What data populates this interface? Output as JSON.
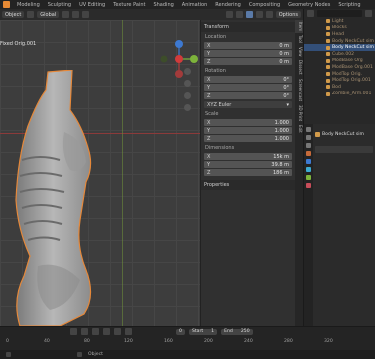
{
  "menubar": {
    "tabs": [
      "Modeling",
      "Sculpting",
      "UV Editing",
      "Texture Paint",
      "Shading",
      "Animation",
      "Rendering",
      "Compositing",
      "Geometry Nodes",
      "Scripting"
    ],
    "active_index": 0
  },
  "viewport_header": {
    "mode": "Object",
    "orientation": "Global",
    "options_label": "Options"
  },
  "viewport": {
    "view_label": "Fixed Orig.001"
  },
  "npanel": {
    "transform_title": "Transform",
    "location_label": "Location",
    "location": [
      {
        "axis": "X",
        "value": "0 m"
      },
      {
        "axis": "Y",
        "value": "0 m"
      },
      {
        "axis": "Z",
        "value": "0 m"
      }
    ],
    "rotation_label": "Rotation",
    "rotation": [
      {
        "axis": "X",
        "value": "0°"
      },
      {
        "axis": "Y",
        "value": "0°"
      },
      {
        "axis": "Z",
        "value": "0°"
      }
    ],
    "rotation_mode": "XYZ Euler",
    "scale_label": "Scale",
    "scale": [
      {
        "axis": "X",
        "value": "1.000"
      },
      {
        "axis": "Y",
        "value": "1.000"
      },
      {
        "axis": "Z",
        "value": "1.000"
      }
    ],
    "dimensions_label": "Dimensions",
    "dimensions": [
      {
        "axis": "X",
        "value": "15k m"
      },
      {
        "axis": "Y",
        "value": "39.8 m"
      },
      {
        "axis": "Z",
        "value": "186 m"
      }
    ],
    "properties_title": "Properties",
    "tabs": [
      "Item",
      "Tool",
      "View",
      "Dissect",
      "Screencast",
      "3D Print",
      "Edit"
    ]
  },
  "outliner": {
    "items": [
      {
        "label": "Light",
        "selected": false
      },
      {
        "label": "Blocks",
        "selected": false
      },
      {
        "label": "Head",
        "selected": false
      },
      {
        "label": "Body NeckCut sim",
        "selected": false
      },
      {
        "label": "Body NeckCut sim",
        "selected": true
      },
      {
        "label": "Cube.002",
        "selected": false
      },
      {
        "label": "ModBase Org",
        "selected": false
      },
      {
        "label": "ModBase Org.001",
        "selected": false
      },
      {
        "label": "ModTop Orig.",
        "selected": false
      },
      {
        "label": "ModTop Orig.001",
        "selected": false
      },
      {
        "label": "Bod",
        "selected": false
      },
      {
        "label": "Zombie_Arm.001",
        "selected": false
      }
    ]
  },
  "properties": {
    "object_name": "Body NeckCut sim"
  },
  "timeline": {
    "current_frame": "0",
    "start_label": "Start",
    "start_value": "1",
    "end_label": "End",
    "end_value": "250",
    "ruler_ticks": [
      "0",
      "40",
      "80",
      "120",
      "160",
      "200",
      "240",
      "280",
      "320"
    ]
  },
  "statusbar": {
    "object_label": "Object"
  },
  "colors": {
    "accent": "#334f78",
    "selection_outline": "#e5883a",
    "x_axis": "#d13b3b",
    "y_axis": "#7db33b",
    "z_axis": "#3d79d1"
  }
}
